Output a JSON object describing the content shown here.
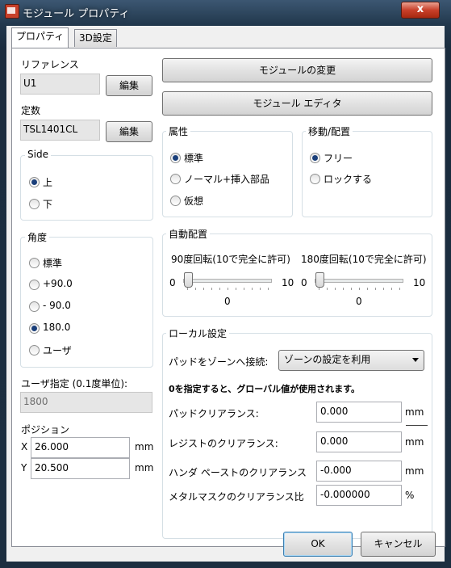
{
  "window": {
    "title": "モジュール プロパティ",
    "close_glyph": "x"
  },
  "tabs": [
    {
      "label": "プロパティ",
      "active": true
    },
    {
      "label": "3D設定",
      "active": false
    }
  ],
  "reference": {
    "label": "リファレンス",
    "value": "U1",
    "edit_label": "編集"
  },
  "value_field": {
    "label": "定数",
    "value": "TSL1401CL",
    "edit_label": "編集"
  },
  "side": {
    "title": "Side",
    "options": [
      {
        "label": "上",
        "selected": true
      },
      {
        "label": "下",
        "selected": false
      }
    ]
  },
  "angle": {
    "title": "角度",
    "options": [
      {
        "label": "標準",
        "selected": false
      },
      {
        "label": "+90.0",
        "selected": false
      },
      {
        "label": "- 90.0",
        "selected": false
      },
      {
        "label": "180.0",
        "selected": true
      },
      {
        "label": "ユーザ",
        "selected": false
      }
    ]
  },
  "user_angle": {
    "label": "ユーザ指定 (0.1度単位):",
    "value": "1800"
  },
  "position": {
    "label": "ポジション",
    "x_label": "X",
    "x_value": "26.000",
    "x_unit": "mm",
    "y_label": "Y",
    "y_value": "20.500",
    "y_unit": "mm"
  },
  "buttons": {
    "change_module": "モジュールの変更",
    "module_editor": "モジュール エディタ",
    "ok": "OK",
    "cancel": "キャンセル"
  },
  "attributes": {
    "title": "属性",
    "options": [
      {
        "label": "標準",
        "selected": true
      },
      {
        "label": "ノーマル+挿入部品",
        "selected": false
      },
      {
        "label": "仮想",
        "selected": false
      }
    ]
  },
  "move": {
    "title": "移動/配置",
    "options": [
      {
        "label": "フリー",
        "selected": true
      },
      {
        "label": "ロックする",
        "selected": false
      }
    ]
  },
  "auto_place": {
    "title": "自動配置",
    "slider90": {
      "label": "90度回転(10で完全に許可)",
      "min": "0",
      "max": "10",
      "value": "0",
      "level": 0
    },
    "slider180": {
      "label": "180度回転(10で完全に許可)",
      "min": "0",
      "max": "10",
      "value": "0",
      "level": 0
    }
  },
  "local": {
    "title": "ローカル設定",
    "pad_zone_label": "パッドをゾーンへ接続:",
    "pad_zone_value": "ゾーンの設定を利用",
    "note": "0を指定すると、グローバル値が使用されます。",
    "rows": [
      {
        "label": "パッドクリアランス:",
        "value": "0.000",
        "unit": "mm"
      },
      {
        "label": "レジストのクリアランス:",
        "value": "0.000",
        "unit": "mm"
      },
      {
        "label": "ハンダ ペーストのクリアランス",
        "value": "-0.000",
        "unit": "mm"
      },
      {
        "label": "メタルマスクのクリアランス比",
        "value": "-0.000000",
        "unit": "%"
      }
    ]
  }
}
